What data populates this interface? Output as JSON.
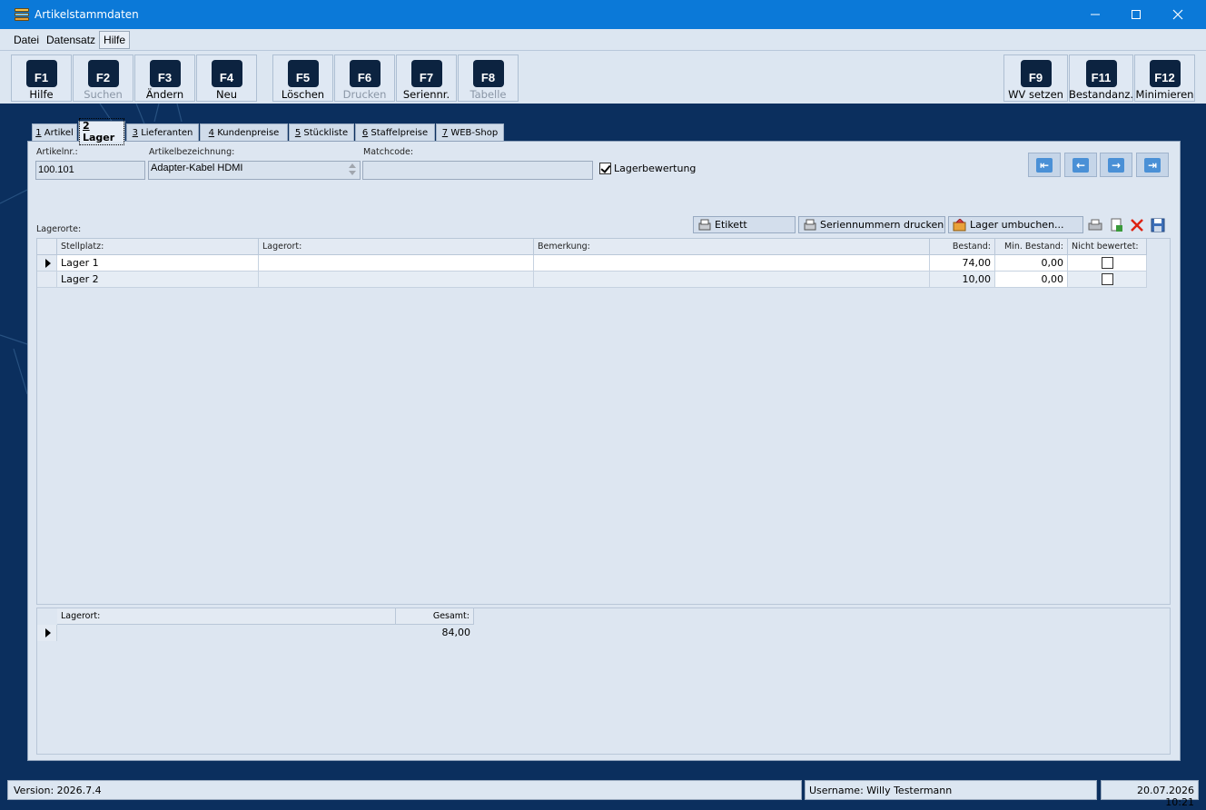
{
  "window": {
    "title": "Artikelstammdaten"
  },
  "menu": [
    "Datei",
    "Datensatz",
    "Hilfe"
  ],
  "toolbar": {
    "buttons": [
      {
        "key": "F1",
        "label": "Hilfe"
      },
      {
        "key": "F2",
        "label": "Suchen"
      },
      {
        "key": "F3",
        "label": "Ändern"
      },
      {
        "key": "F4",
        "label": "Neu"
      },
      {
        "key": "F5",
        "label": "Löschen"
      },
      {
        "key": "F6",
        "label": "Drucken"
      },
      {
        "key": "F7",
        "label": "Seriennr."
      },
      {
        "key": "F8",
        "label": "Tabelle"
      },
      {
        "key": "F9",
        "label": "WV setzen"
      },
      {
        "key": "F11",
        "label": "Bestandanz."
      },
      {
        "key": "F12",
        "label": "Minimieren"
      }
    ]
  },
  "tabs": [
    {
      "num": "1",
      "label": " Artikel"
    },
    {
      "num": "2",
      "label": " Lager"
    },
    {
      "num": "3",
      "label": " Lieferanten"
    },
    {
      "num": "4",
      "label": " Kundenpreise"
    },
    {
      "num": "5",
      "label": " Stückliste"
    },
    {
      "num": "6",
      "label": " Staffelpreise"
    },
    {
      "num": "7",
      "label": " WEB-Shop"
    }
  ],
  "form": {
    "artikelnr_label": "Artikelnr.:",
    "artikelnr": "100.101",
    "bezeichnung_label": "Artikelbezeichnung:",
    "bezeichnung": "Adapter-Kabel HDMI",
    "matchcode_label": "Matchcode:",
    "matchcode": "",
    "lagerbewertung_label": "Lagerbewertung"
  },
  "lagerorte_label": "Lagerorte:",
  "actions": {
    "etikett": "Etikett",
    "seriennummern": "Seriennummern drucken",
    "umbuchen": "Lager umbuchen..."
  },
  "grid": {
    "headers": [
      "Stellplatz:",
      "Lagerort:",
      "Bemerkung:",
      "Bestand:",
      "Min. Bestand:",
      "Nicht bewertet:"
    ],
    "rows": [
      {
        "stellplatz": "Lager 1",
        "lagerort": "",
        "bemerkung": "",
        "bestand": "74,00",
        "min_bestand": "0,00"
      },
      {
        "stellplatz": "Lager 2",
        "lagerort": "",
        "bemerkung": "",
        "bestand": "10,00",
        "min_bestand": "0,00"
      }
    ]
  },
  "summary": {
    "headers": [
      "Lagerort:",
      "Gesamt:"
    ],
    "rows": [
      {
        "lagerort": "",
        "gesamt": "84,00"
      }
    ]
  },
  "statusbar": {
    "version": "Version: 2026.7.4",
    "user": "Username: Willy Testermann",
    "datetime": "20.07.2026 10:21"
  }
}
